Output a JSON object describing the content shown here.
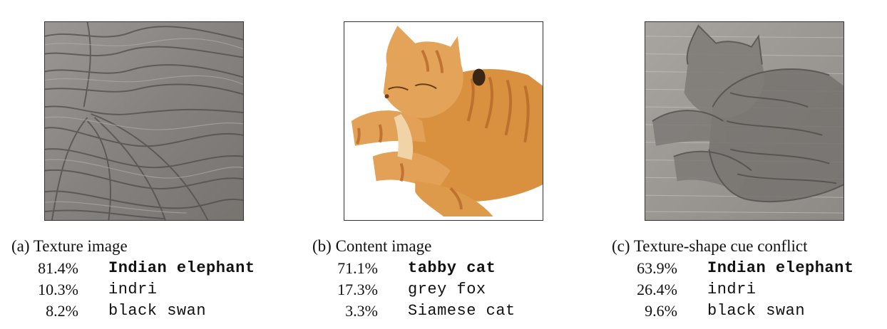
{
  "panels": [
    {
      "caption": "(a) Texture image",
      "image": "elephant-skin-texture",
      "predictions": [
        {
          "pct": "81.4%",
          "label": "Indian elephant"
        },
        {
          "pct": "10.3%",
          "label": "indri"
        },
        {
          "pct": "8.2%",
          "label": "black swan"
        }
      ]
    },
    {
      "caption": "(b) Content image",
      "image": "tabby-cat-photo",
      "predictions": [
        {
          "pct": "71.1%",
          "label": "tabby cat"
        },
        {
          "pct": "17.3%",
          "label": "grey fox"
        },
        {
          "pct": "3.3%",
          "label": "Siamese cat"
        }
      ]
    },
    {
      "caption": "(c) Texture-shape cue conflict",
      "image": "cat-shape-with-elephant-texture",
      "predictions": [
        {
          "pct": "63.9%",
          "label": "Indian elephant"
        },
        {
          "pct": "26.4%",
          "label": "indri"
        },
        {
          "pct": "9.6%",
          "label": "black swan"
        }
      ]
    }
  ],
  "colors": {
    "elephant_skin": "#8a8886",
    "elephant_crease": "#4f4c49",
    "cat_fur": "#d9913f",
    "cat_stripe": "#b8692a"
  }
}
